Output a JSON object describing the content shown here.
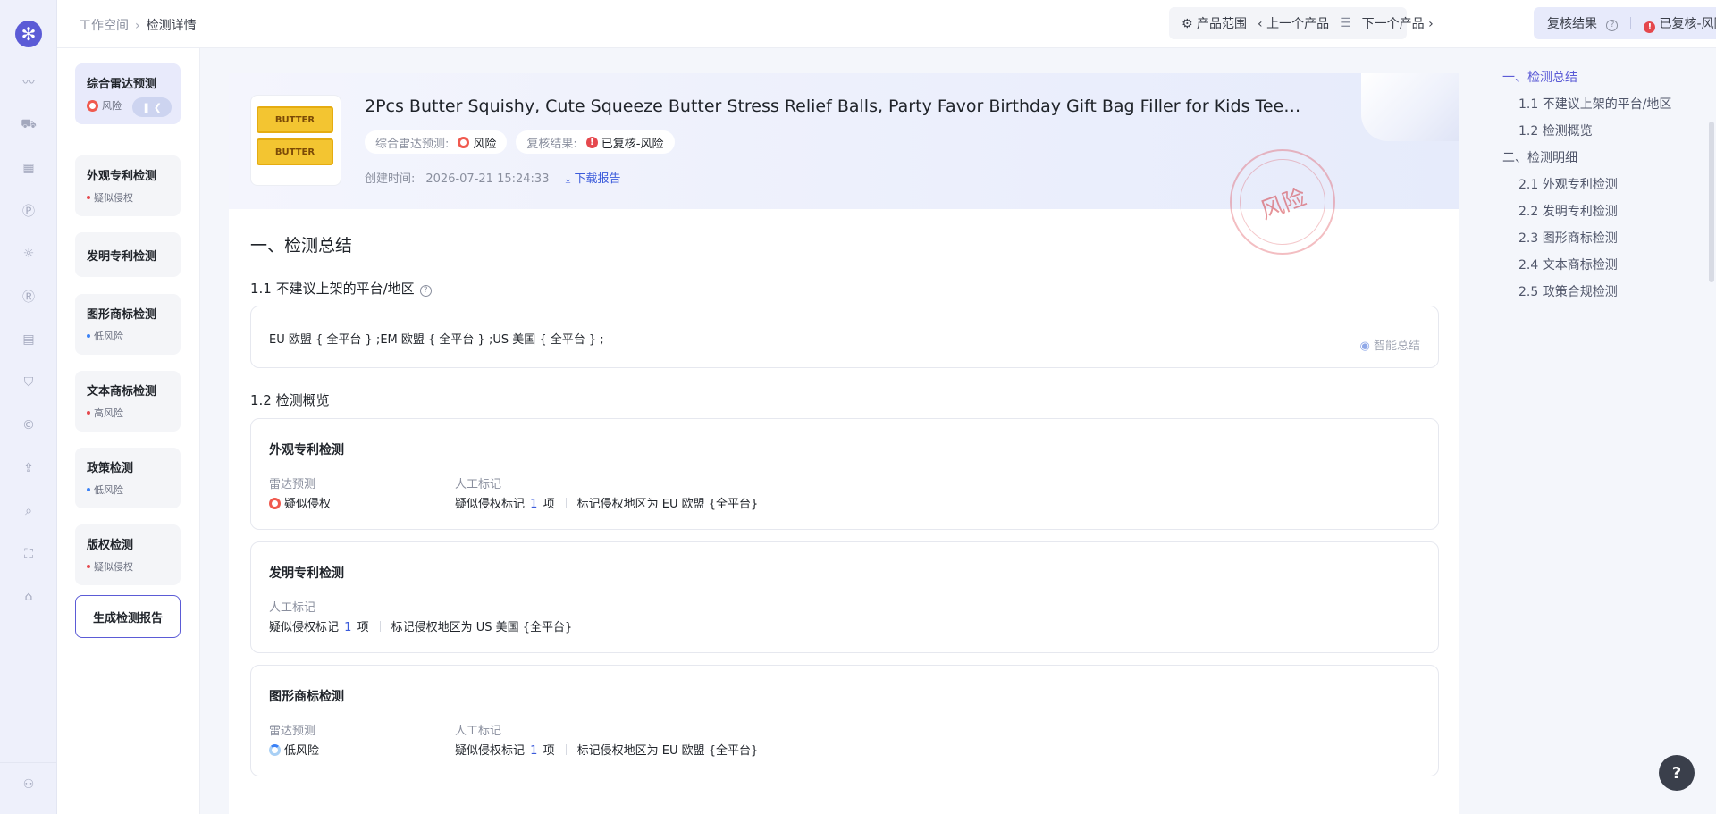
{
  "breadcrumb": {
    "root": "工作空间",
    "current": "检测详情"
  },
  "topnav": {
    "product_scope": "产品范围",
    "prev": "上一个产品",
    "next": "下一个产品"
  },
  "review": {
    "label": "复核结果",
    "status": "已复核-风险"
  },
  "sidenav": [
    {
      "title": "综合雷达预测",
      "status": "风险",
      "status_color": "#f05a4f"
    },
    {
      "title": "外观专利检测",
      "status": "疑似侵权",
      "status_color": "#e5484d"
    },
    {
      "title": "发明专利检测",
      "status": ""
    },
    {
      "title": "图形商标检测",
      "status": "低风险",
      "status_color": "#3b82f6"
    },
    {
      "title": "文本商标检测",
      "status": "高风险",
      "status_color": "#e5484d"
    },
    {
      "title": "政策检测",
      "status": "低风险",
      "status_color": "#3b82f6"
    },
    {
      "title": "版权检测",
      "status": "疑似侵权",
      "status_color": "#e5484d"
    }
  ],
  "generate_report": "生成检测报告",
  "product": {
    "title": "2Pcs Butter Squishy, Cute Squeeze Butter Stress Relief Balls, Party Favor Birthday Gift Bag Filler for Kids Teens…",
    "radar_label": "综合雷达预测:",
    "radar_value": "风险",
    "review_label": "复核结果:",
    "review_value": "已复核-风险",
    "created_label": "创建时间:",
    "created_value": "2026-07-21 15:24:33",
    "download": "下载报告",
    "thumb_text": "BUTTER",
    "stamp_text": "风险"
  },
  "section1": {
    "title": "一、检测总结",
    "sub1": "1.1 不建议上架的平台/地区",
    "regions": "EU 欧盟 { 全平台 } ;EM 欧盟 { 全平台 } ;US 美国 { 全平台 } ;",
    "smart_summary": "智能总结",
    "sub2": "1.2 检测概览"
  },
  "cards": [
    {
      "title": "外观专利检测",
      "radar_label": "雷达预测",
      "radar_value": "疑似侵权",
      "manual_label": "人工标记",
      "mark_prefix": "疑似侵权标记",
      "mark_count": "1",
      "mark_unit": "项",
      "region_text": "标记侵权地区为 EU 欧盟 {全平台}"
    },
    {
      "title": "发明专利检测",
      "manual_label": "人工标记",
      "mark_prefix": "疑似侵权标记",
      "mark_count": "1",
      "mark_unit": "项",
      "region_text": "标记侵权地区为 US 美国 {全平台}"
    },
    {
      "title": "图形商标检测",
      "radar_label": "雷达预测",
      "radar_value": "低风险",
      "manual_label": "人工标记",
      "mark_prefix": "疑似侵权标记",
      "mark_count": "1",
      "mark_unit": "项",
      "region_text": "标记侵权地区为 EU 欧盟 {全平台}"
    }
  ],
  "toc": [
    "一、检测总结",
    "1.1 不建议上架的平台/地区",
    "1.2 检测概览",
    "二、检测明细",
    "2.1 外观专利检测",
    "2.2 发明专利检测",
    "2.3 图形商标检测",
    "2.4 文本商标检测",
    "2.5 政策合规检测"
  ],
  "colors": {
    "accent": "#5b5bd6",
    "link": "#3b5bdb",
    "danger": "#e5484d",
    "low": "#3b82f6"
  }
}
